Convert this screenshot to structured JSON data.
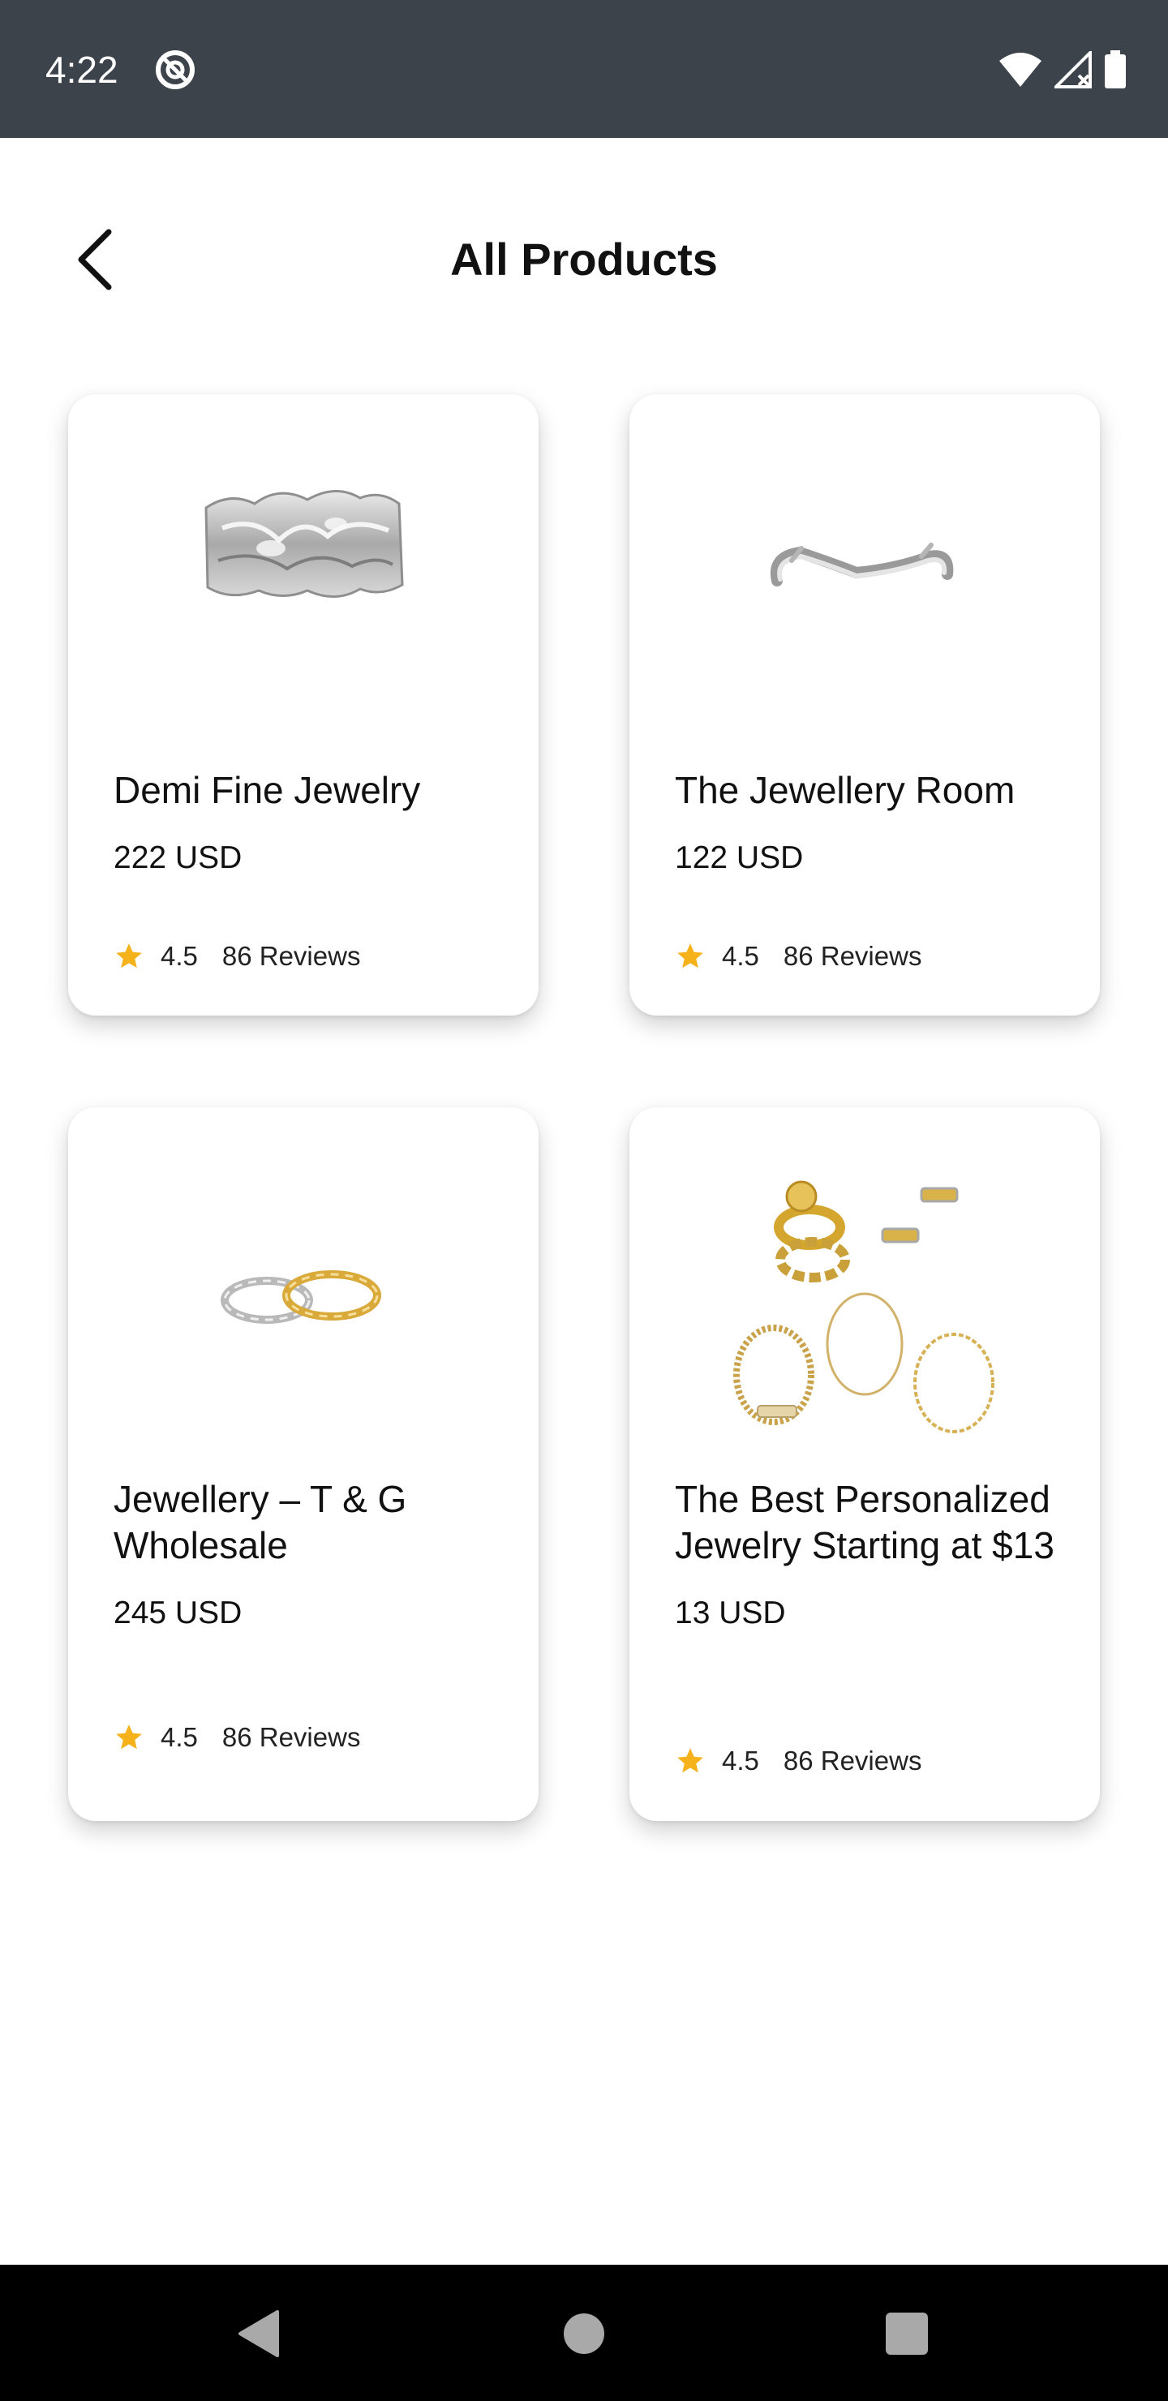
{
  "status_bar": {
    "time": "4:22",
    "icons": [
      "app-notification-icon",
      "wifi-icon",
      "signal-icon",
      "battery-icon"
    ]
  },
  "header": {
    "title": "All Products",
    "back_icon": "chevron-left-icon"
  },
  "products": [
    {
      "name": "Demi Fine Jewelry",
      "price": "222 USD",
      "rating": "4.5",
      "reviews": "86 Reviews",
      "image": "silver-ring"
    },
    {
      "name": "The Jewellery Room",
      "price": "122 USD",
      "rating": "4.5",
      "reviews": "86 Reviews",
      "image": "silver-cuff"
    },
    {
      "name": "Jewellery – T & G Wholesale",
      "price": "245 USD",
      "rating": "4.5",
      "reviews": "86 Reviews",
      "image": "two-tone-rings"
    },
    {
      "name": "The Best Personalized Jewelry Starting at $13",
      "price": "13 USD",
      "rating": "4.5",
      "reviews": "86 Reviews",
      "image": "gold-jewelry-set"
    }
  ],
  "colors": {
    "status_bar": "#3d434b",
    "star": "#f6b21b",
    "nav_bar": "#000000",
    "nav_icon": "#a9a9a9"
  },
  "nav": {
    "icons": [
      "back-triangle-icon",
      "home-circle-icon",
      "recents-square-icon"
    ]
  }
}
